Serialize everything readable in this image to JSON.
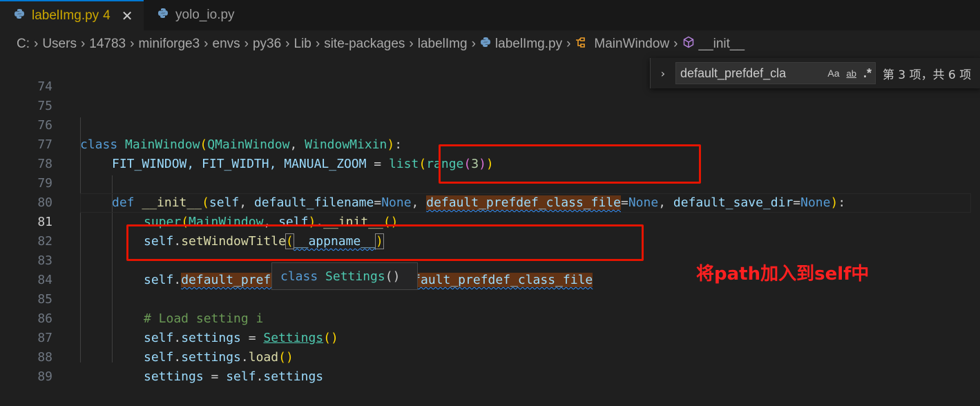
{
  "tabs": [
    {
      "label": "labelImg.py",
      "badge": "4",
      "active": true,
      "close": "✕"
    },
    {
      "label": "yolo_io.py",
      "badge": "",
      "active": false,
      "close": ""
    }
  ],
  "breadcrumb": {
    "items": [
      "C:",
      "Users",
      "14783",
      "miniforge3",
      "envs",
      "py36",
      "Lib",
      "site-packages",
      "labelImg",
      "labelImg.py",
      "MainWindow",
      "__init__"
    ],
    "separator": "›"
  },
  "find_widget": {
    "toggle": "›",
    "query": "default_prefdef_cla",
    "options": {
      "match_case": "Aa",
      "whole_word": "ab",
      "regex": ".*"
    },
    "count": "第 3 项，共 6 项"
  },
  "editor": {
    "current_line": "81",
    "line_numbers": [
      "74",
      "75",
      "76",
      "77",
      "78",
      "79",
      "80",
      "81",
      "82",
      "83",
      "84",
      "85",
      "86",
      "87",
      "88",
      "89"
    ],
    "code": {
      "l76": {
        "kw": "class",
        "name": "MainWindow",
        "open": "(",
        "base1": "QMainWindow",
        "comma": ", ",
        "base2": "WindowMixin",
        "close": ")",
        "colon": ":"
      },
      "l77": {
        "consts": "FIT_WINDOW, FIT_WIDTH, MANUAL_ZOOM",
        "eq": " = ",
        "fn": "list",
        "o1": "(",
        "fn2": "range",
        "o2": "(",
        "num": "3",
        "c2": ")",
        "c1": ")"
      },
      "l79": {
        "kw": "def",
        "name": "__init__",
        "open": "(",
        "self": "self",
        "s1": ", ",
        "p1": "default_filename",
        "eq1": "=",
        "none1": "None",
        "s2": ", ",
        "p2": "default_prefdef_class_file",
        "eq2": "=",
        "none2": "None",
        "s3": ", ",
        "p3": "default_save_dir",
        "eq3": "=",
        "none3": "None",
        "close": ")",
        "colon": ":"
      },
      "l80": {
        "fn": "super",
        "open": "(",
        "cls": "MainWindow",
        "sep": ", ",
        "self": "self",
        "close": ")",
        "dot": ".",
        "method": "__init__",
        "call": "()"
      },
      "l81": {
        "self": "self",
        "dot": ".",
        "method": "setWindowTitle",
        "open": "(",
        "arg": "__appname__",
        "close": ")"
      },
      "l83": {
        "self": "self",
        "dot": ".",
        "attr": "default_prefdef_class_file",
        "eq": " = ",
        "val": "default_prefdef_class_file"
      },
      "l85": {
        "comment": "# Load setting i"
      },
      "l86": {
        "self": "self",
        "dot": ".",
        "attr": "settings",
        "eq": " = ",
        "cls": "Settings",
        "call": "()"
      },
      "l87": {
        "self": "self",
        "dot": ".",
        "attr": "settings",
        "dot2": ".",
        "method": "load",
        "call": "()"
      },
      "l88": {
        "var": "settings",
        "eq": " = ",
        "self": "self",
        "dot": ".",
        "attr": "settings"
      }
    }
  },
  "hover_tooltip": {
    "kw": "class",
    "name": "Settings",
    "parens": "()"
  },
  "annotation": {
    "text": "将path加入到self中",
    "color": "#ff2020"
  },
  "colors": {
    "annotation_box": "#e51400",
    "active_tab_text": "#cca700",
    "background": "#1f1f1f"
  }
}
